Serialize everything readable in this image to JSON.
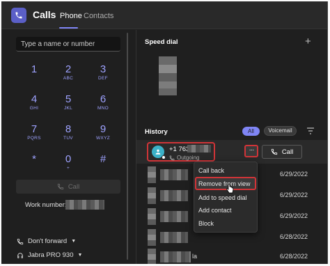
{
  "app": {
    "title": "Calls",
    "tabs": [
      "Phone",
      "Contacts"
    ],
    "active_tab": "Phone",
    "accent": "#7f85f5",
    "highlight": "#d13438"
  },
  "dialer": {
    "search_placeholder": "Type a name or number",
    "keys": [
      {
        "num": "1",
        "letters": ""
      },
      {
        "num": "2",
        "letters": "ABC"
      },
      {
        "num": "3",
        "letters": "DEF"
      },
      {
        "num": "4",
        "letters": "GHI"
      },
      {
        "num": "5",
        "letters": "JKL"
      },
      {
        "num": "6",
        "letters": "MNO"
      },
      {
        "num": "7",
        "letters": "PQRS"
      },
      {
        "num": "8",
        "letters": "TUV"
      },
      {
        "num": "9",
        "letters": "WXYZ"
      },
      {
        "num": "*",
        "letters": ""
      },
      {
        "num": "0",
        "letters": "+"
      },
      {
        "num": "#",
        "letters": ""
      }
    ],
    "call_label": "Call",
    "work_number_label": "Work number:",
    "forward_label": "Don't forward",
    "device_label": "Jabra PRO 930"
  },
  "speed_dial": {
    "title": "Speed dial"
  },
  "history": {
    "title": "History",
    "filters": [
      "All",
      "Voicemail"
    ],
    "active_filter": "All",
    "entry": {
      "number": "+1 763-",
      "direction": "Outgoing",
      "call_label": "Call",
      "more_label": "···"
    },
    "rows": [
      {
        "name": "",
        "date": "6/29/2022"
      },
      {
        "name": "",
        "date": "6/29/2022"
      },
      {
        "name": "",
        "date": "6/29/2022"
      },
      {
        "name": "",
        "date": "6/28/2022"
      },
      {
        "name": "la",
        "date": "6/28/2022"
      }
    ]
  },
  "context_menu": {
    "items": [
      "Call back",
      "Remove from view",
      "Add to speed dial",
      "Add contact",
      "Block"
    ],
    "highlighted": "Remove from view"
  }
}
